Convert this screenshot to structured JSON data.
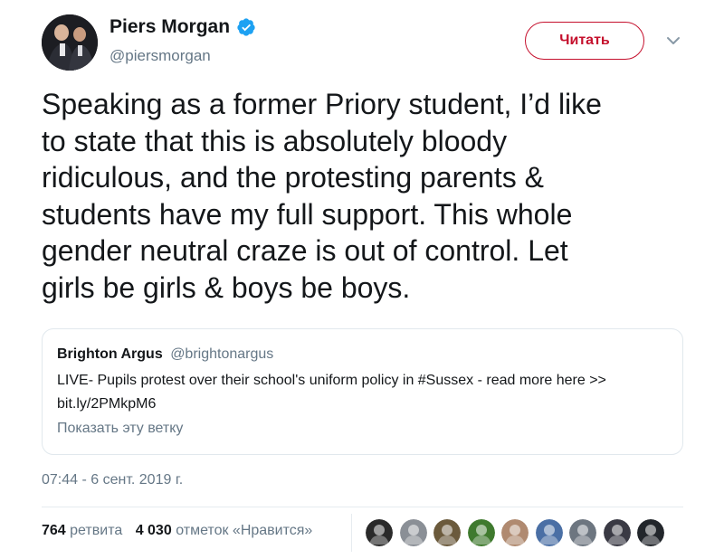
{
  "author": {
    "display_name": "Piers Morgan",
    "handle": "@piersmorgan",
    "verified": true,
    "avatar_icon": "profile-photo-icon"
  },
  "follow_button": {
    "label": "Читать",
    "color": "#c5102d"
  },
  "more_menu": {
    "icon": "chevron-down-icon"
  },
  "tweet": {
    "text": "Speaking as a former Priory student, I’d like\nto state that this is absolutely bloody\nridiculous, and the protesting parents &\nstudents have my full support. This whole\ngender neutral craze is out of control. Let\ngirls be girls & boys be boys."
  },
  "quoted_tweet": {
    "name": "Brighton Argus",
    "handle": "@brightonargus",
    "text_line1": "LIVE- Pupils protest over their school's uniform policy in #Sussex - read more here >>",
    "text_line2": "bit.ly/2PMkpM6",
    "show_thread": "Показать эту ветку"
  },
  "timestamp": "07:44 - 6 сент. 2019 г.",
  "stats": {
    "retweets_count": "764",
    "retweets_label": "ретвита",
    "likes_count": "4 030",
    "likes_label": "отметок «Нравится»"
  },
  "likers": [
    {
      "icon": "liker-avatar-icon",
      "color": "#2a2a2a"
    },
    {
      "icon": "liker-avatar-icon",
      "color": "#8a8f96"
    },
    {
      "icon": "liker-avatar-icon",
      "color": "#6b5a3c"
    },
    {
      "icon": "liker-avatar-icon",
      "color": "#3f7a2e"
    },
    {
      "icon": "liker-avatar-icon",
      "color": "#b08a70"
    },
    {
      "icon": "liker-avatar-icon",
      "color": "#4a6fa5"
    },
    {
      "icon": "liker-avatar-icon",
      "color": "#6d7680"
    },
    {
      "icon": "liker-avatar-icon",
      "color": "#3a3a44"
    },
    {
      "icon": "liker-avatar-icon",
      "color": "#22262b"
    }
  ],
  "colors": {
    "verified_blue": "#1da1f2",
    "muted_text": "#657786",
    "border": "#e1e8ed"
  }
}
